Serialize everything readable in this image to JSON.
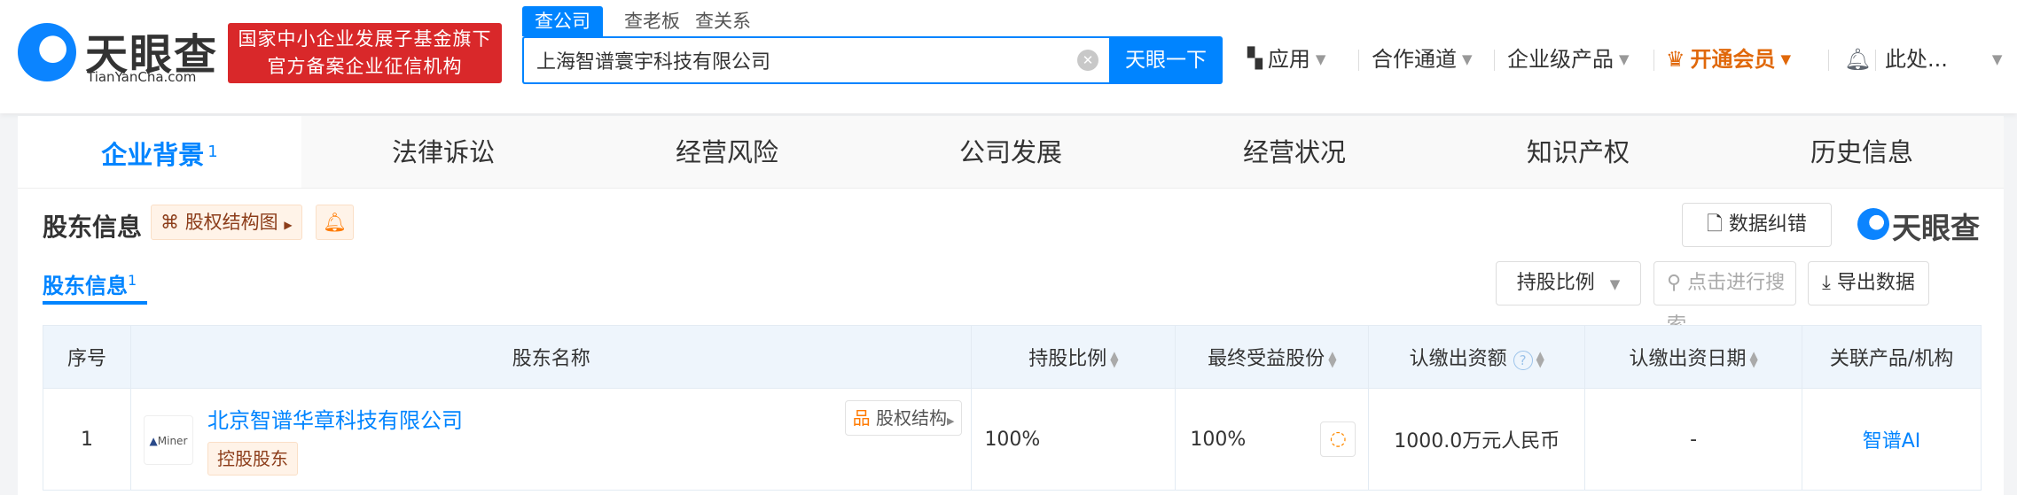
{
  "header": {
    "logo_text": "天眼查",
    "logo_sub": "TianYanCha.com",
    "banner_line1": "国家中小企业发展子基金旗下",
    "banner_line2": "官方备案企业征信机构",
    "search_tabs": [
      "查公司",
      "查老板",
      "查关系"
    ],
    "search_value": "上海智谱寰宇科技有限公司",
    "search_button": "天眼一下",
    "nav": {
      "apps": "应用",
      "channel": "合作通道",
      "enterprise": "企业级产品",
      "vip": "开通会员",
      "user": "此处..."
    }
  },
  "tabs": [
    {
      "label": "企业背景",
      "count": "1"
    },
    {
      "label": "法律诉讼"
    },
    {
      "label": "经营风险"
    },
    {
      "label": "公司发展"
    },
    {
      "label": "经营状况"
    },
    {
      "label": "知识产权"
    },
    {
      "label": "历史信息"
    }
  ],
  "section": {
    "title": "股东信息",
    "equity_chart_btn": "股权结构图",
    "report_error": "数据纠错",
    "watermark": "天眼查",
    "subtab": "股东信息",
    "subtab_count": "1",
    "filter_ratio": "持股比例",
    "search_placeholder": "点击进行搜索",
    "export": "导出数据"
  },
  "table": {
    "columns": [
      "序号",
      "股东名称",
      "持股比例",
      "最终受益股份",
      "认缴出资额",
      "认缴出资日期",
      "关联产品/机构"
    ],
    "rows": [
      {
        "index": "1",
        "logo_text": "Miner",
        "name": "北京智谱华章科技有限公司",
        "tag": "控股股东",
        "equity_btn": "股权结构",
        "ratio": "100%",
        "beneficial": "100%",
        "amount": "1000.0万元人民币",
        "date": "-",
        "product": "智谱AI"
      }
    ]
  },
  "colors": {
    "brand": "#0084ff",
    "banner": "#d9282a",
    "vip": "#e0680a"
  }
}
